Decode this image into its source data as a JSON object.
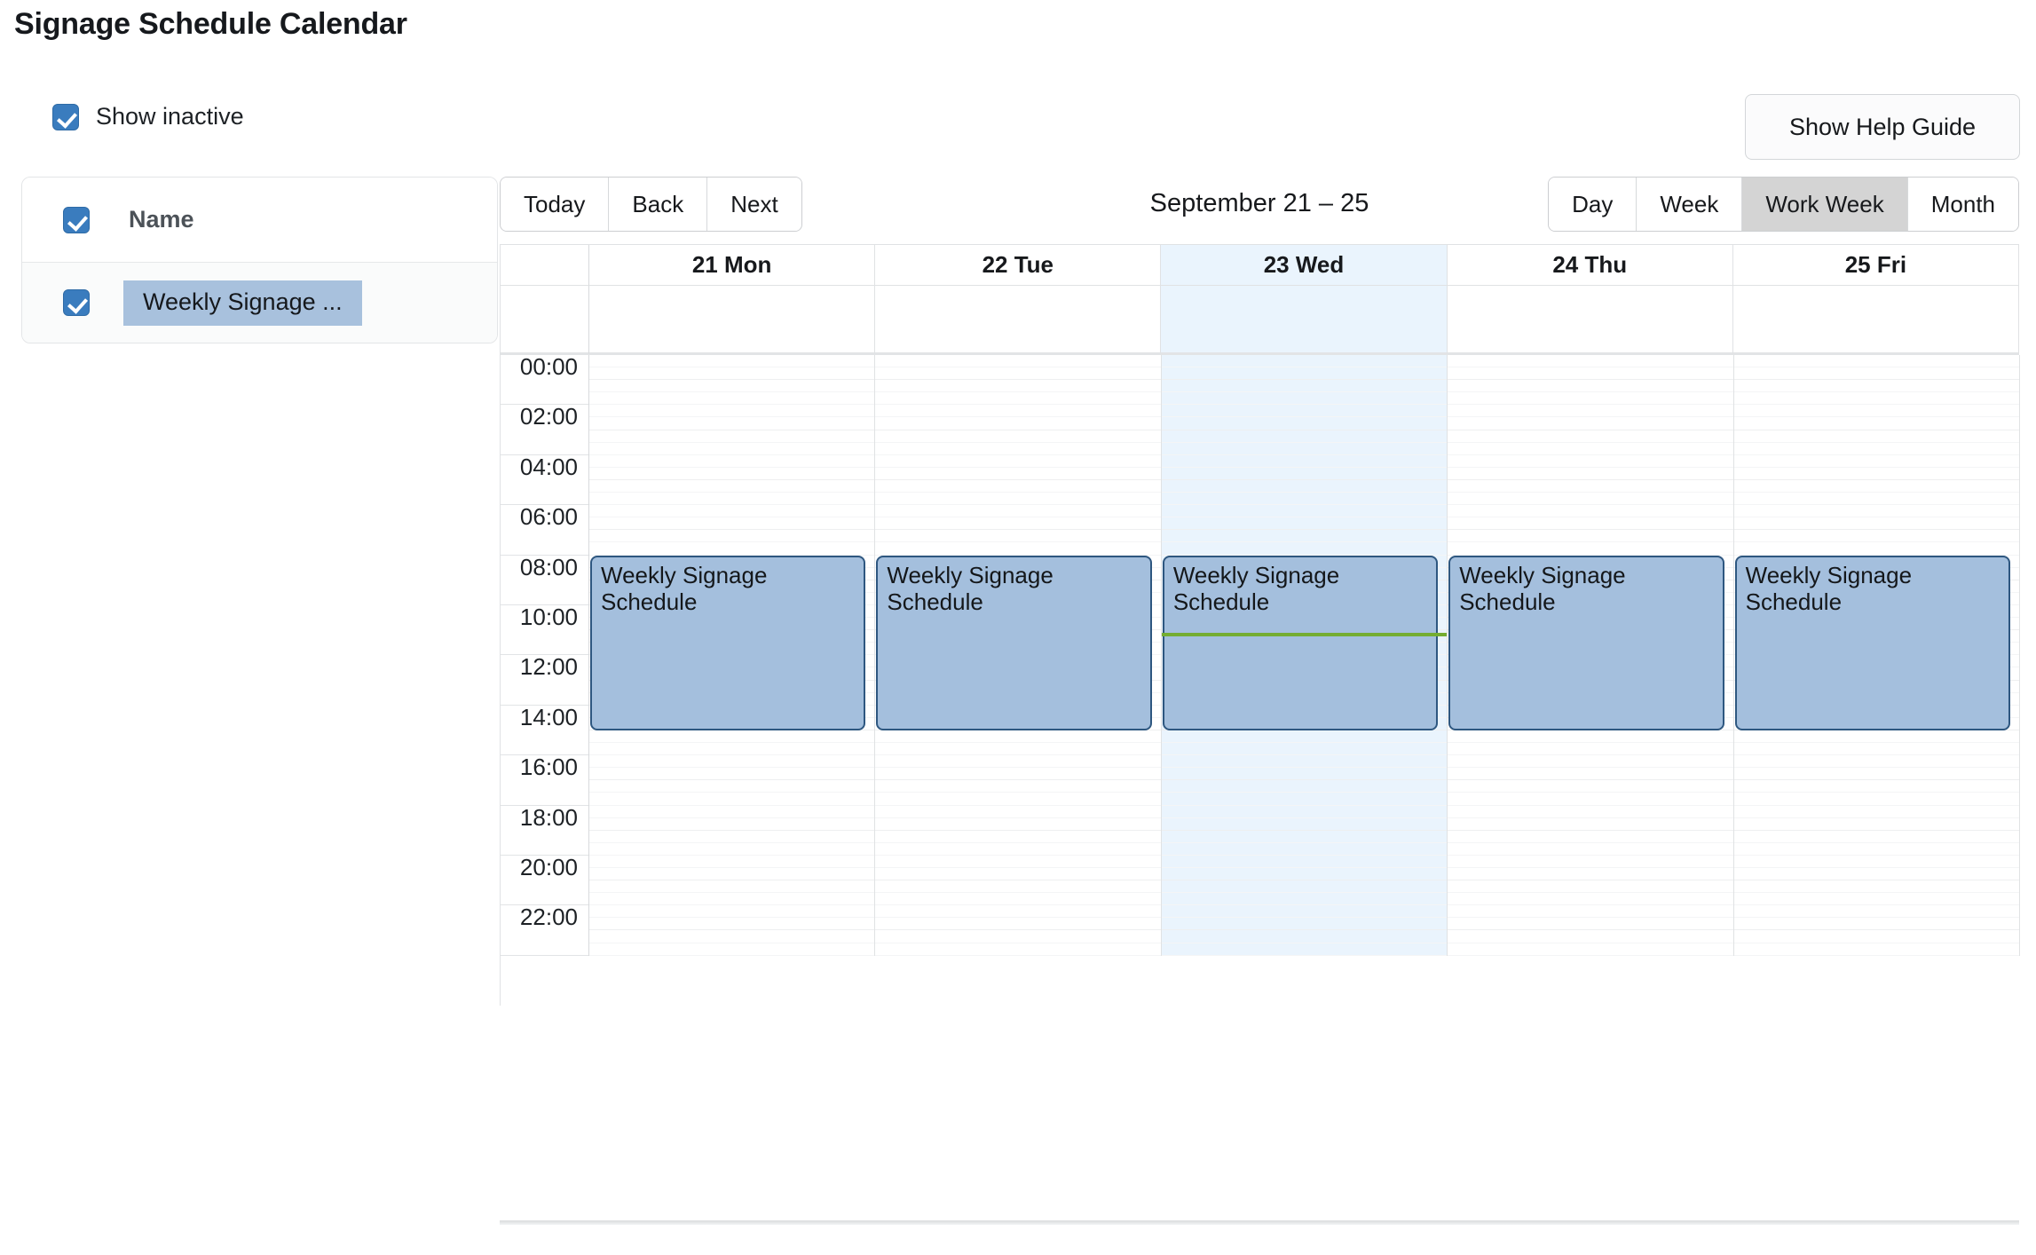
{
  "page_title": "Signage Schedule Calendar",
  "show_inactive": {
    "label": "Show inactive",
    "checked": true
  },
  "help_button": {
    "label": "Show Help Guide"
  },
  "sidebar": {
    "header": {
      "label": "Name",
      "checked": true
    },
    "rows": [
      {
        "label": "Weekly Signage ...",
        "checked": true
      }
    ]
  },
  "toolbar": {
    "nav": [
      {
        "label": "Today",
        "active": false
      },
      {
        "label": "Back",
        "active": false
      },
      {
        "label": "Next",
        "active": false
      }
    ],
    "range_label": "September 21 – 25",
    "views": [
      {
        "label": "Day",
        "active": false
      },
      {
        "label": "Week",
        "active": false
      },
      {
        "label": "Work Week",
        "active": true
      },
      {
        "label": "Month",
        "active": false
      }
    ]
  },
  "calendar": {
    "view": "Work Week",
    "days": [
      {
        "header": "21 Mon",
        "today": false
      },
      {
        "header": "22 Tue",
        "today": false
      },
      {
        "header": "23 Wed",
        "today": true
      },
      {
        "header": "24 Thu",
        "today": false
      },
      {
        "header": "25 Fri",
        "today": false
      }
    ],
    "time_labels": [
      "00:00",
      "02:00",
      "04:00",
      "06:00",
      "08:00",
      "10:00",
      "12:00",
      "14:00",
      "16:00",
      "18:00",
      "20:00",
      "22:00"
    ],
    "slot_hours": 2,
    "subslots_per_block": 4,
    "events": [
      {
        "day": 0,
        "title": "Weekly Signage Schedule",
        "start": "08:00",
        "end": "15:00"
      },
      {
        "day": 1,
        "title": "Weekly Signage Schedule",
        "start": "08:00",
        "end": "15:00"
      },
      {
        "day": 2,
        "title": "Weekly Signage Schedule",
        "start": "08:00",
        "end": "15:00"
      },
      {
        "day": 3,
        "title": "Weekly Signage Schedule",
        "start": "08:00",
        "end": "15:00"
      },
      {
        "day": 4,
        "title": "Weekly Signage Schedule",
        "start": "08:00",
        "end": "15:00"
      }
    ],
    "current_time_indicator": {
      "day": 2,
      "time": "11:05"
    }
  },
  "colors": {
    "accent": "#3a7cbe",
    "event_fill": "#a4bfdd",
    "event_border": "#2e5780",
    "today_tint": "#eaf4fd",
    "now_line": "#74ad31",
    "active_tab": "#d4d4d4"
  }
}
